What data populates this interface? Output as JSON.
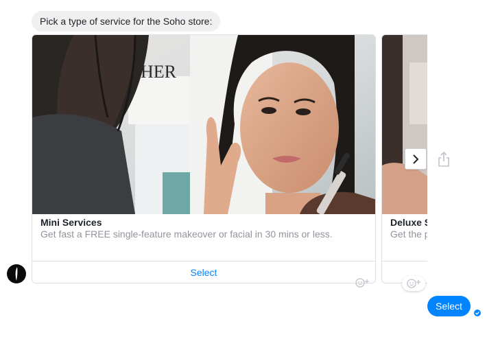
{
  "conversation": {
    "prompt_text": "Pick a type of service for the Soho store:",
    "sent_message": "Select"
  },
  "carousel": {
    "cards": [
      {
        "title": "Mini Services",
        "subtitle": "Get fast a FREE single-feature makeover or facial in 30 mins or less.",
        "button_label": "Select",
        "photo_sign_text": "HER"
      },
      {
        "title": "Deluxe S",
        "subtitle": "Get the p required.",
        "button_label": ""
      }
    ]
  },
  "icons": {
    "next": "chevron-right-icon",
    "share": "share-icon",
    "reaction": "add-reaction-icon",
    "delivered": "delivered-check-icon",
    "avatar": "sephora-logo"
  },
  "colors": {
    "accent": "#0084ff",
    "bubble_gray": "#f1f0f0",
    "muted_text": "#90949c",
    "border": "#dddfe2"
  }
}
